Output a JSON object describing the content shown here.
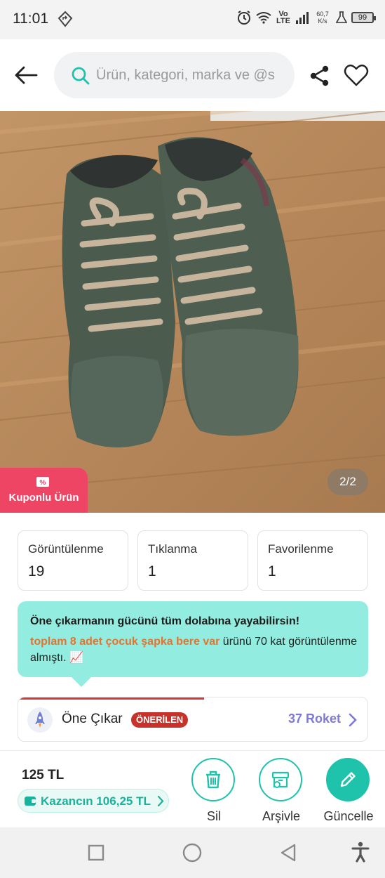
{
  "status_bar": {
    "time": "11:01",
    "network": "Vo LTE",
    "speed_value": "60,7",
    "speed_unit": "K/s",
    "battery": "99"
  },
  "header": {
    "search_placeholder": "Ürün, kategori, marka ve @s",
    "icons": [
      "back-arrow-icon",
      "search-icon",
      "share-icon",
      "heart-icon"
    ]
  },
  "product_image": {
    "description_icon": "shoe-photo",
    "page_indicator": "2/2",
    "coupon_label": "Kuponlu Ürün"
  },
  "stats": [
    {
      "label": "Görüntülenme",
      "value": "19"
    },
    {
      "label": "Tıklanma",
      "value": "1"
    },
    {
      "label": "Favorilenme",
      "value": "1"
    }
  ],
  "tip": {
    "title": "Öne çıkarmanın gücünü tüm dolabına yayabilirsin!",
    "highlight": "toplam 8 adet çocuk şapka bere var",
    "body": " ürünü 70 kat görüntülenme almıştı. 📈"
  },
  "boost": {
    "title": "Öne Çıkar",
    "badge": "ÖNERİLEN",
    "price": "37 Roket"
  },
  "bottom": {
    "price": "125 TL",
    "earning": "Kazancın 106,25 TL",
    "actions": [
      {
        "label": "Sil",
        "icon": "trash-icon"
      },
      {
        "label": "Arşivle",
        "icon": "archive-icon"
      },
      {
        "label": "Güncelle",
        "icon": "pencil-icon"
      }
    ]
  },
  "colors": {
    "accent": "#1fc2aa",
    "coupon": "#ee4565",
    "tip_bg": "#92ede0",
    "highlight": "#e8722d",
    "badge": "#c7332a",
    "rocket_price": "#7d79d6"
  }
}
